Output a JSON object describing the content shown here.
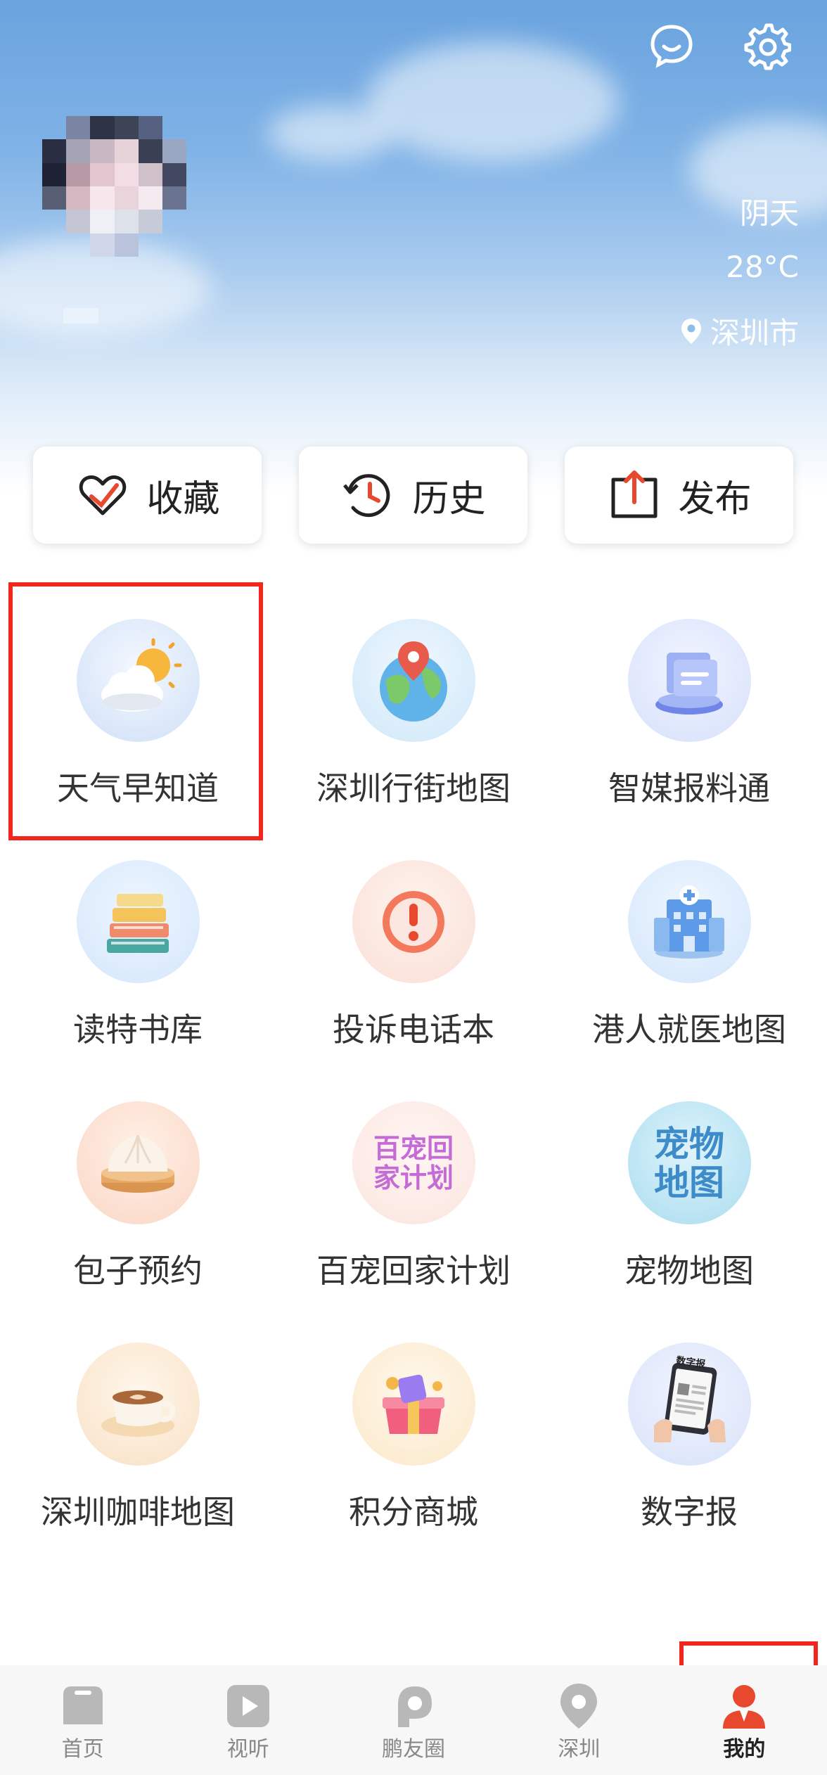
{
  "header": {
    "weather_condition": "阴天",
    "temperature": "28°C",
    "city": "深圳市"
  },
  "quick_actions": [
    {
      "label": "收藏",
      "icon": "heart-icon"
    },
    {
      "label": "历史",
      "icon": "history-icon"
    },
    {
      "label": "发布",
      "icon": "upload-icon"
    }
  ],
  "services": [
    {
      "label": "天气早知道",
      "icon": "weather-icon"
    },
    {
      "label": "深圳行街地图",
      "icon": "globe-map-icon"
    },
    {
      "label": "智媒报料通",
      "icon": "files-icon"
    },
    {
      "label": "读特书库",
      "icon": "books-icon"
    },
    {
      "label": "投诉电话本",
      "icon": "alert-icon"
    },
    {
      "label": "港人就医地图",
      "icon": "hospital-icon"
    },
    {
      "label": "包子预约",
      "icon": "bun-icon"
    },
    {
      "label": "百宠回家计划",
      "icon": "pet-home-icon",
      "icon_text": "百宠回家计划"
    },
    {
      "label": "宠物地图",
      "icon": "pet-map-icon",
      "icon_text": "宠物地图"
    },
    {
      "label": "深圳咖啡地图",
      "icon": "coffee-icon"
    },
    {
      "label": "积分商城",
      "icon": "gift-icon"
    },
    {
      "label": "数字报",
      "icon": "tablet-news-icon",
      "icon_text": "数字报"
    }
  ],
  "tabbar": [
    {
      "label": "首页",
      "icon": "home-icon",
      "active": false
    },
    {
      "label": "视听",
      "icon": "play-icon",
      "active": false
    },
    {
      "label": "鹏友圈",
      "icon": "friends-icon",
      "active": false
    },
    {
      "label": "深圳",
      "icon": "location-icon",
      "active": false
    },
    {
      "label": "我的",
      "icon": "profile-icon",
      "active": true
    }
  ],
  "colors": {
    "highlight": "#f2261c",
    "active_tab": "#e8492e",
    "inactive_tab": "#b8b8b8"
  }
}
